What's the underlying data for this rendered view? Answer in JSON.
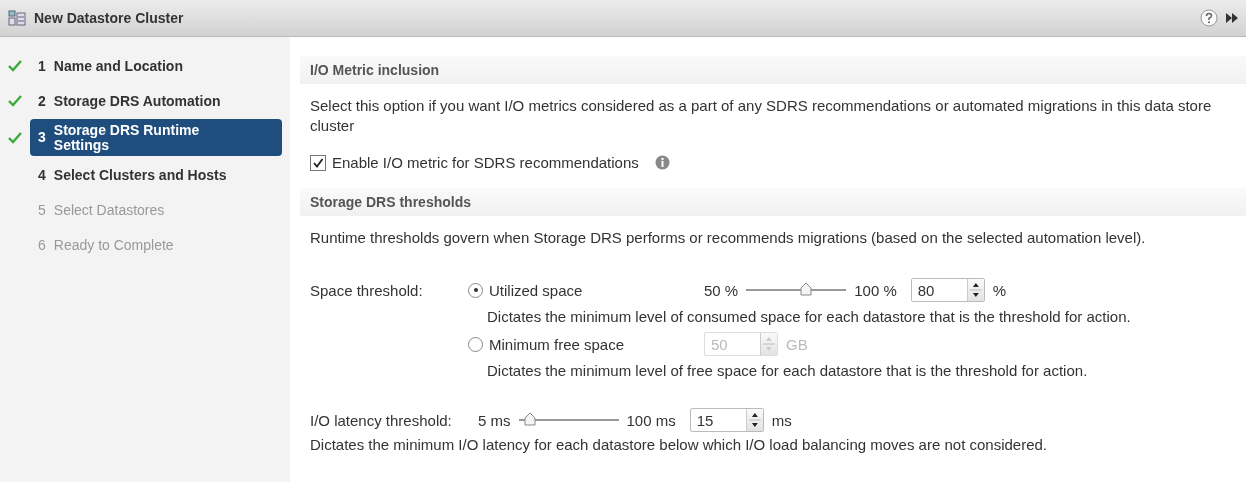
{
  "window": {
    "title": "New Datastore Cluster"
  },
  "steps": [
    {
      "number": "1",
      "label": "Name and Location",
      "completed": true,
      "selected": false,
      "disabled": false
    },
    {
      "number": "2",
      "label": "Storage DRS Automation",
      "completed": true,
      "selected": false,
      "disabled": false
    },
    {
      "number": "3",
      "label": "Storage DRS Runtime Settings",
      "completed": true,
      "selected": true,
      "disabled": false
    },
    {
      "number": "4",
      "label": "Select Clusters and Hosts",
      "completed": false,
      "selected": false,
      "disabled": false
    },
    {
      "number": "5",
      "label": "Select Datastores",
      "completed": false,
      "selected": false,
      "disabled": true
    },
    {
      "number": "6",
      "label": "Ready to Complete",
      "completed": false,
      "selected": false,
      "disabled": true
    }
  ],
  "io_metric": {
    "header": "I/O Metric inclusion",
    "description": "Select this option if you want I/O metrics considered as a part of any SDRS recommendations or automated migrations in this data store cluster",
    "checkbox": {
      "label": "Enable I/O metric for SDRS recommendations",
      "checked": true
    }
  },
  "thresholds": {
    "header": "Storage DRS thresholds",
    "description": "Runtime thresholds govern when Storage DRS performs or recommends migrations (based on the selected automation level).",
    "space": {
      "label": "Space threshold:",
      "options": [
        {
          "label": "Utilized space",
          "selected": true,
          "slider": {
            "min_label": "50 %",
            "max_label": "100 %",
            "level": 0.6
          },
          "spinner": {
            "value": "80",
            "unit": "%",
            "disabled": false
          },
          "description": "Dictates the minimum level of consumed space for each datastore that is the threshold for action."
        },
        {
          "label": "Minimum free space",
          "selected": false,
          "spinner": {
            "value": "50",
            "unit": "GB",
            "disabled": true
          },
          "description": "Dictates the minimum level of free space for each datastore that is the threshold for action."
        }
      ]
    },
    "latency": {
      "label": "I/O latency threshold:",
      "slider": {
        "min_label": "5 ms",
        "max_label": "100 ms",
        "level": 0.11
      },
      "spinner": {
        "value": "15",
        "unit": "ms",
        "disabled": false
      },
      "description": "Dictates the minimum I/O latency for each datastore below which I/O load balancing moves are not considered."
    }
  }
}
